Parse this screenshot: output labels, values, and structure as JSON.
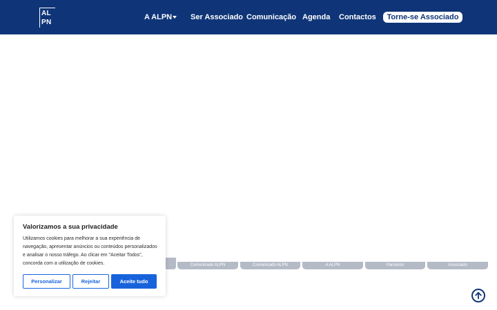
{
  "header": {
    "logo": {
      "line1": "AL",
      "line2": "PN"
    },
    "nav": [
      {
        "label": "A ALPN",
        "has_dropdown": true
      },
      {
        "label": "Ser Associado"
      },
      {
        "label": "Comunicação"
      },
      {
        "label": "Agenda"
      },
      {
        "label": "Contactos"
      }
    ],
    "cta_label": "Torne-se Associado"
  },
  "chips": [
    "Comunicado ALPN",
    "Comunicado ALPN",
    "A ALPN",
    "Parceiros",
    "Associado"
  ],
  "cookie_banner": {
    "title": "Valorizamos a sua privacidade",
    "text": "Utilizamos cookies para melhorar a sua experiência de navegação, apresentar anúncios ou conteúdos personalizados e analisar o nosso tráfego. Ao clicar em \"Aceitar Todos\", concorda com a utilização de cookies.",
    "buttons": {
      "customize": "Personalizar",
      "reject": "Rejeitar",
      "accept": "Aceite tudo"
    }
  },
  "icons": {
    "scroll_top": "arrow-up-circle-icon",
    "dropdown": "caret-down-icon"
  },
  "colors": {
    "header_bg": "#0f3578",
    "accent": "#1863dc",
    "chip_bg": "#b4bac6"
  }
}
